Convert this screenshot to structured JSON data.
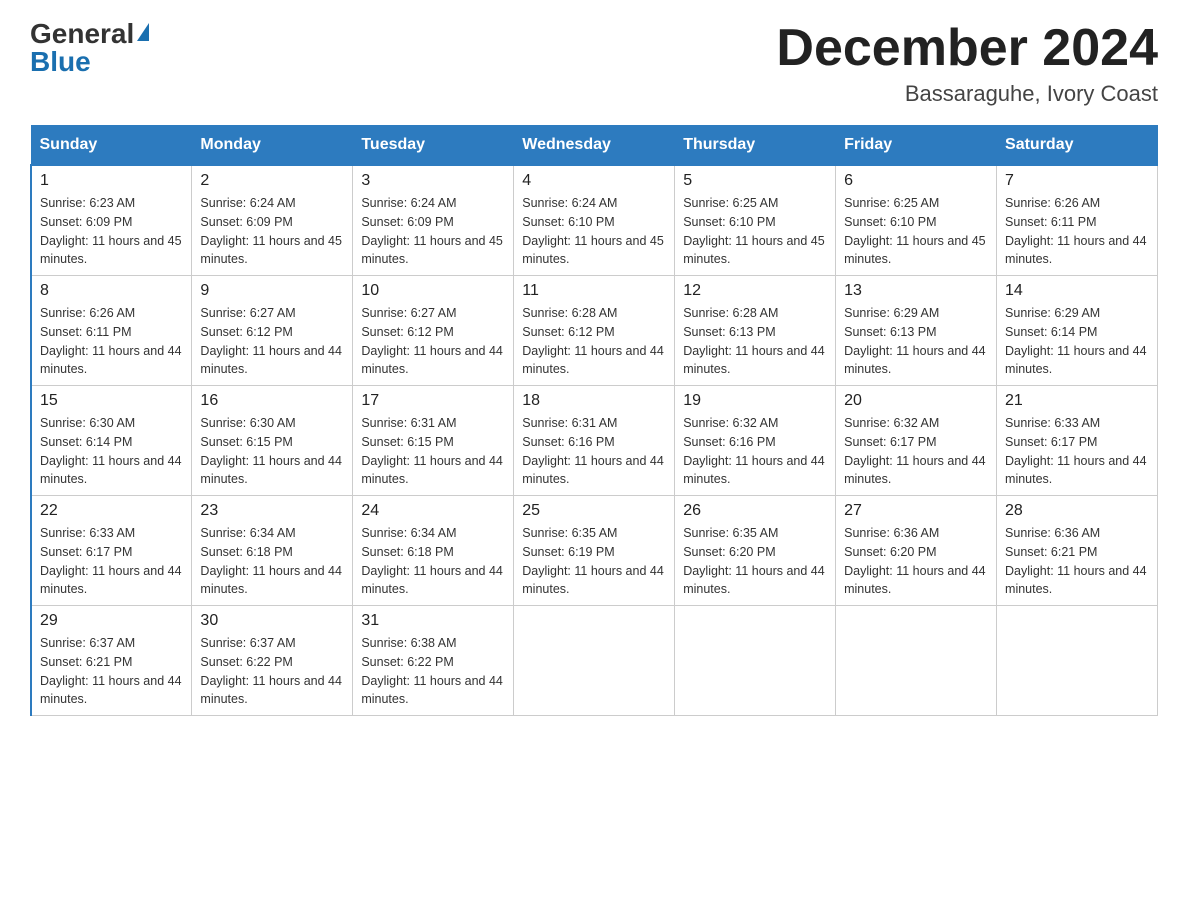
{
  "header": {
    "logo_general": "General",
    "logo_blue": "Blue",
    "month_title": "December 2024",
    "location": "Bassaraguhe, Ivory Coast"
  },
  "columns": [
    "Sunday",
    "Monday",
    "Tuesday",
    "Wednesday",
    "Thursday",
    "Friday",
    "Saturday"
  ],
  "weeks": [
    [
      {
        "day": "1",
        "sunrise": "6:23 AM",
        "sunset": "6:09 PM",
        "daylight": "11 hours and 45 minutes."
      },
      {
        "day": "2",
        "sunrise": "6:24 AM",
        "sunset": "6:09 PM",
        "daylight": "11 hours and 45 minutes."
      },
      {
        "day": "3",
        "sunrise": "6:24 AM",
        "sunset": "6:09 PM",
        "daylight": "11 hours and 45 minutes."
      },
      {
        "day": "4",
        "sunrise": "6:24 AM",
        "sunset": "6:10 PM",
        "daylight": "11 hours and 45 minutes."
      },
      {
        "day": "5",
        "sunrise": "6:25 AM",
        "sunset": "6:10 PM",
        "daylight": "11 hours and 45 minutes."
      },
      {
        "day": "6",
        "sunrise": "6:25 AM",
        "sunset": "6:10 PM",
        "daylight": "11 hours and 45 minutes."
      },
      {
        "day": "7",
        "sunrise": "6:26 AM",
        "sunset": "6:11 PM",
        "daylight": "11 hours and 44 minutes."
      }
    ],
    [
      {
        "day": "8",
        "sunrise": "6:26 AM",
        "sunset": "6:11 PM",
        "daylight": "11 hours and 44 minutes."
      },
      {
        "day": "9",
        "sunrise": "6:27 AM",
        "sunset": "6:12 PM",
        "daylight": "11 hours and 44 minutes."
      },
      {
        "day": "10",
        "sunrise": "6:27 AM",
        "sunset": "6:12 PM",
        "daylight": "11 hours and 44 minutes."
      },
      {
        "day": "11",
        "sunrise": "6:28 AM",
        "sunset": "6:12 PM",
        "daylight": "11 hours and 44 minutes."
      },
      {
        "day": "12",
        "sunrise": "6:28 AM",
        "sunset": "6:13 PM",
        "daylight": "11 hours and 44 minutes."
      },
      {
        "day": "13",
        "sunrise": "6:29 AM",
        "sunset": "6:13 PM",
        "daylight": "11 hours and 44 minutes."
      },
      {
        "day": "14",
        "sunrise": "6:29 AM",
        "sunset": "6:14 PM",
        "daylight": "11 hours and 44 minutes."
      }
    ],
    [
      {
        "day": "15",
        "sunrise": "6:30 AM",
        "sunset": "6:14 PM",
        "daylight": "11 hours and 44 minutes."
      },
      {
        "day": "16",
        "sunrise": "6:30 AM",
        "sunset": "6:15 PM",
        "daylight": "11 hours and 44 minutes."
      },
      {
        "day": "17",
        "sunrise": "6:31 AM",
        "sunset": "6:15 PM",
        "daylight": "11 hours and 44 minutes."
      },
      {
        "day": "18",
        "sunrise": "6:31 AM",
        "sunset": "6:16 PM",
        "daylight": "11 hours and 44 minutes."
      },
      {
        "day": "19",
        "sunrise": "6:32 AM",
        "sunset": "6:16 PM",
        "daylight": "11 hours and 44 minutes."
      },
      {
        "day": "20",
        "sunrise": "6:32 AM",
        "sunset": "6:17 PM",
        "daylight": "11 hours and 44 minutes."
      },
      {
        "day": "21",
        "sunrise": "6:33 AM",
        "sunset": "6:17 PM",
        "daylight": "11 hours and 44 minutes."
      }
    ],
    [
      {
        "day": "22",
        "sunrise": "6:33 AM",
        "sunset": "6:17 PM",
        "daylight": "11 hours and 44 minutes."
      },
      {
        "day": "23",
        "sunrise": "6:34 AM",
        "sunset": "6:18 PM",
        "daylight": "11 hours and 44 minutes."
      },
      {
        "day": "24",
        "sunrise": "6:34 AM",
        "sunset": "6:18 PM",
        "daylight": "11 hours and 44 minutes."
      },
      {
        "day": "25",
        "sunrise": "6:35 AM",
        "sunset": "6:19 PM",
        "daylight": "11 hours and 44 minutes."
      },
      {
        "day": "26",
        "sunrise": "6:35 AM",
        "sunset": "6:20 PM",
        "daylight": "11 hours and 44 minutes."
      },
      {
        "day": "27",
        "sunrise": "6:36 AM",
        "sunset": "6:20 PM",
        "daylight": "11 hours and 44 minutes."
      },
      {
        "day": "28",
        "sunrise": "6:36 AM",
        "sunset": "6:21 PM",
        "daylight": "11 hours and 44 minutes."
      }
    ],
    [
      {
        "day": "29",
        "sunrise": "6:37 AM",
        "sunset": "6:21 PM",
        "daylight": "11 hours and 44 minutes."
      },
      {
        "day": "30",
        "sunrise": "6:37 AM",
        "sunset": "6:22 PM",
        "daylight": "11 hours and 44 minutes."
      },
      {
        "day": "31",
        "sunrise": "6:38 AM",
        "sunset": "6:22 PM",
        "daylight": "11 hours and 44 minutes."
      },
      null,
      null,
      null,
      null
    ]
  ],
  "labels": {
    "sunrise": "Sunrise:",
    "sunset": "Sunset:",
    "daylight": "Daylight:"
  }
}
